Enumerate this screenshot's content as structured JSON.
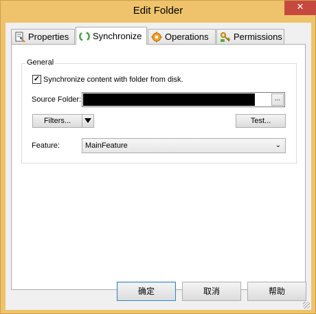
{
  "window": {
    "title": "Edit Folder",
    "close_label": "✕"
  },
  "tabs": [
    {
      "label": "Properties",
      "icon": "properties-icon"
    },
    {
      "label": "Synchronize",
      "icon": "sync-icon"
    },
    {
      "label": "Operations",
      "icon": "gear-icon"
    },
    {
      "label": "Permissions",
      "icon": "key-icon"
    }
  ],
  "active_tab": "Synchronize",
  "general": {
    "group_title": "General",
    "sync_checkbox_label": "Synchronize content with folder from disk.",
    "sync_checked": true,
    "source_folder_label": "Source Folder:",
    "source_folder_value": "",
    "browse_label": "...",
    "filters_label": "Filters...",
    "test_label": "Test...",
    "feature_label": "Feature:",
    "feature_value": "MainFeature"
  },
  "footer": {
    "ok_label": "确定",
    "cancel_label": "取消",
    "help_label": "帮助"
  },
  "colors": {
    "frame": "#eec36b",
    "close": "#c7483f"
  }
}
